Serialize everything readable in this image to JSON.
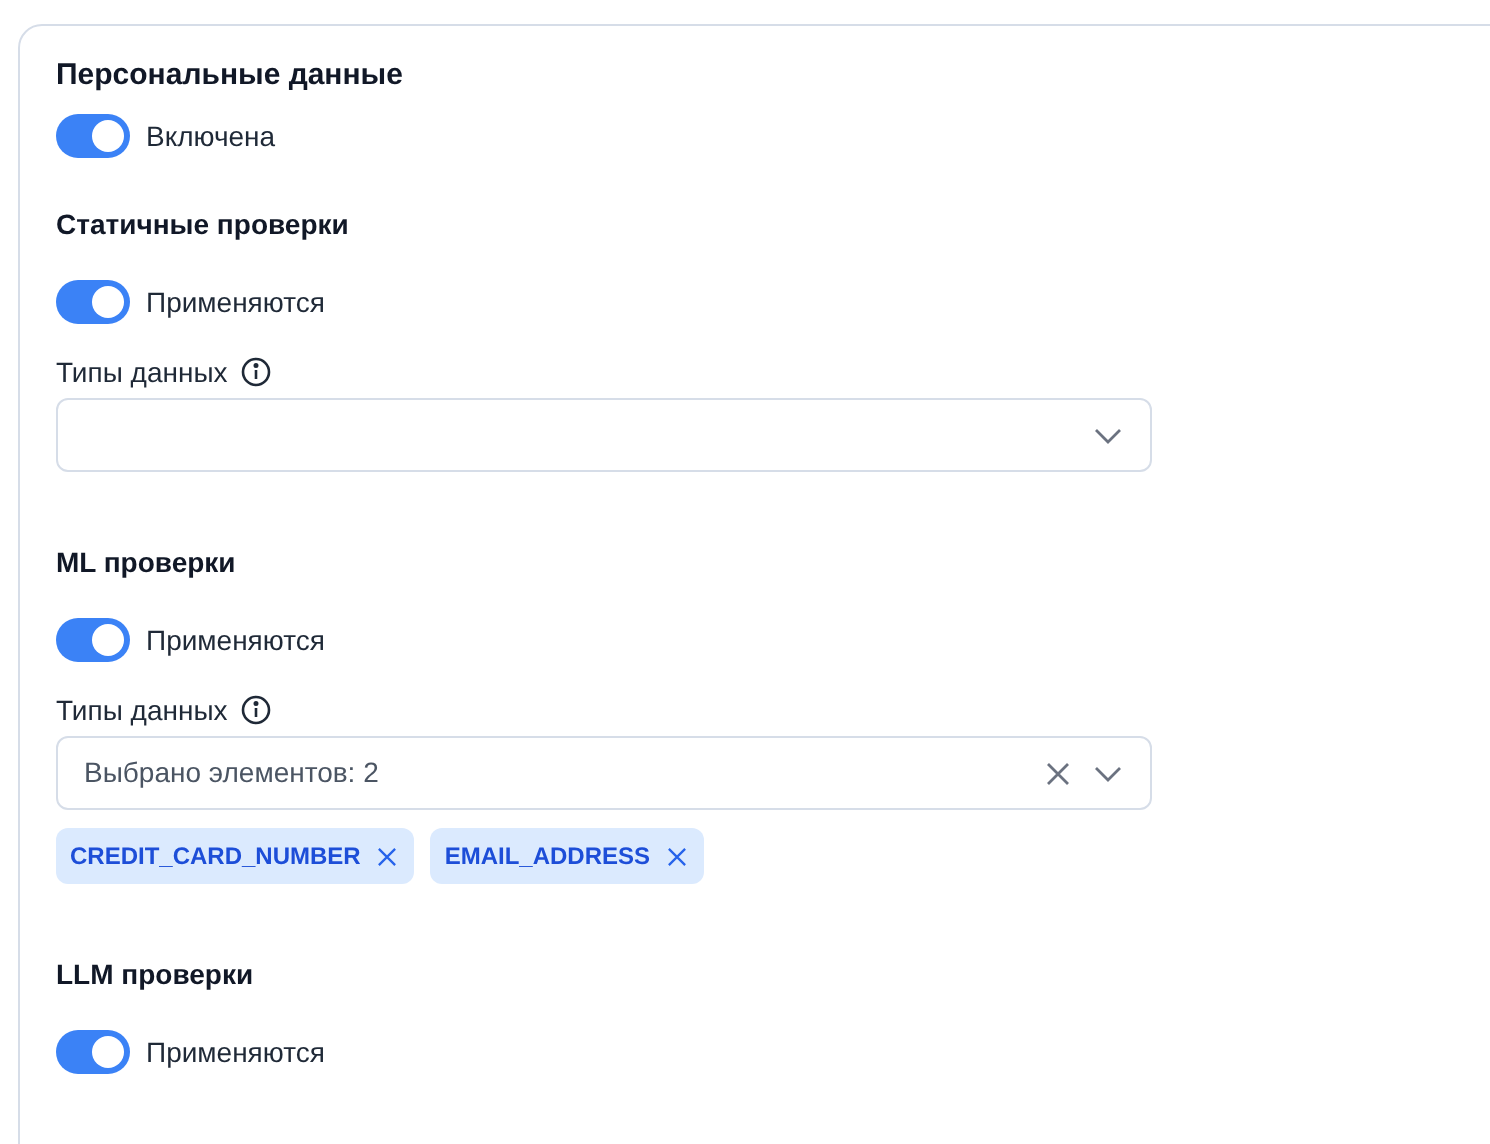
{
  "title": "Персональные данные",
  "master_toggle": {
    "label": "Включена",
    "on": true
  },
  "sections": [
    {
      "title": "Статичные проверки",
      "toggle": {
        "label": "Применяются",
        "on": true
      },
      "field": {
        "label": "Типы данных"
      }
    },
    {
      "title": "ML проверки",
      "toggle": {
        "label": "Применяются",
        "on": true
      },
      "field": {
        "label": "Типы данных",
        "value": "Выбрано элементов: 2",
        "chips": [
          "CREDIT_CARD_NUMBER",
          "EMAIL_ADDRESS"
        ]
      }
    },
    {
      "title": "LLM проверки",
      "toggle": {
        "label": "Применяются",
        "on": true
      }
    }
  ]
}
